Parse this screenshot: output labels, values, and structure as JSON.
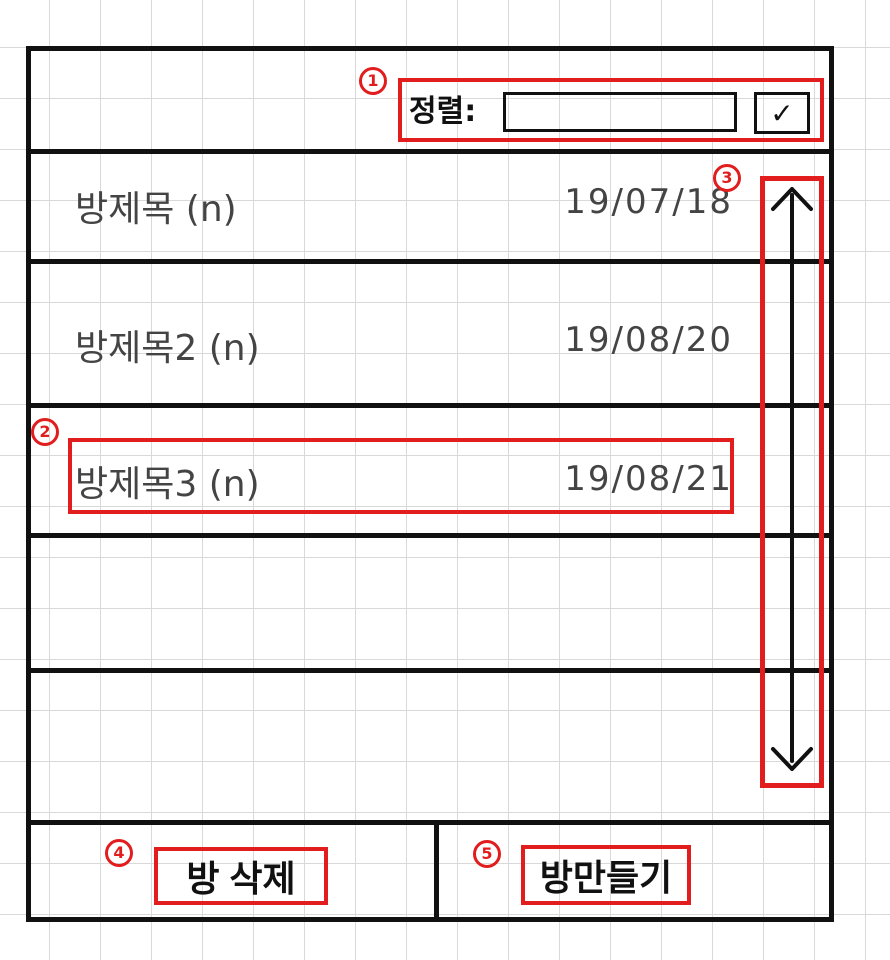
{
  "colors": {
    "annotation_red": "#e11d1d",
    "line_black": "#111111",
    "grid": "#d9d9d9"
  },
  "markers": {
    "sort": "1",
    "list_item": "2",
    "scroll": "3",
    "delete_room": "4",
    "create_room": "5"
  },
  "sort": {
    "label": "정렬:",
    "value": "",
    "checkbox": "✓"
  },
  "rooms": [
    {
      "title": "방제목 (n)",
      "date": "19/07/18"
    },
    {
      "title": "방제목2 (n)",
      "date": "19/08/20"
    },
    {
      "title": "방제목3 (n)",
      "date": "19/08/21"
    }
  ],
  "footer": {
    "delete_label": "방 삭제",
    "create_label": "방만들기"
  }
}
